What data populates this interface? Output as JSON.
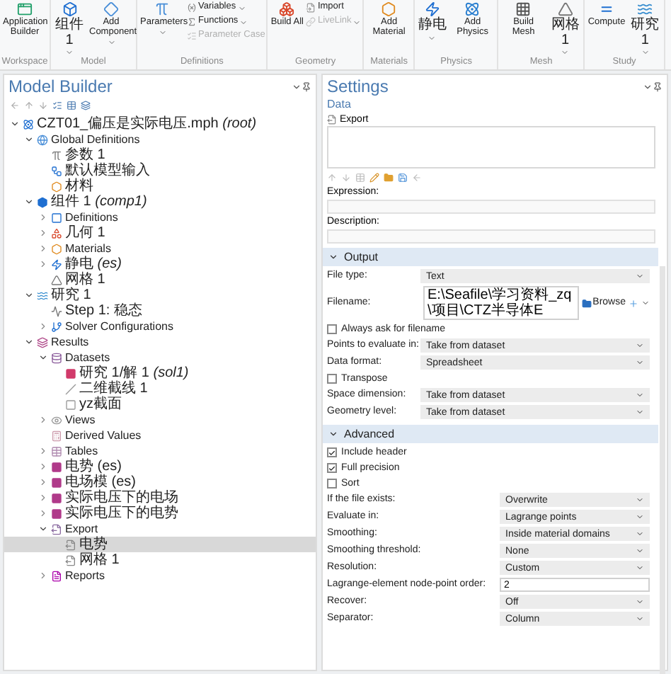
{
  "ribbon": {
    "groups": [
      {
        "label": "Workspace",
        "buttons": [
          {
            "kind": "app",
            "label": "Application Builder",
            "dropdown": false,
            "disabled": false
          }
        ]
      },
      {
        "label": "Model",
        "buttons": [
          {
            "kind": "component",
            "label": "组件 1",
            "dropdown": true,
            "disabled": false
          },
          {
            "kind": "add-component",
            "label": "Add Component",
            "dropdown": true,
            "disabled": false
          }
        ]
      },
      {
        "label": "Definitions",
        "buttons": [
          {
            "kind": "parameters",
            "label": "Parameters",
            "dropdown": true,
            "disabled": false
          }
        ],
        "small": [
          {
            "kind": "variables",
            "label": "Variables",
            "dropdown": true,
            "disabled": false
          },
          {
            "kind": "functions",
            "label": "Functions",
            "dropdown": true,
            "disabled": false
          },
          {
            "kind": "param-case",
            "label": "Parameter Case",
            "dropdown": false,
            "disabled": true
          }
        ]
      },
      {
        "label": "Geometry",
        "buttons": [
          {
            "kind": "build",
            "label": "Build All",
            "dropdown": false,
            "disabled": false
          }
        ],
        "small": [
          {
            "kind": "import",
            "label": "Import",
            "dropdown": false,
            "disabled": false
          },
          {
            "kind": "livelink",
            "label": "LiveLink",
            "dropdown": true,
            "disabled": true
          }
        ]
      },
      {
        "label": "Materials",
        "buttons": [
          {
            "kind": "material",
            "label": "Add Material",
            "dropdown": false,
            "disabled": false
          }
        ]
      },
      {
        "label": "Physics",
        "buttons": [
          {
            "kind": "electrostatics",
            "label": "静电",
            "dropdown": true,
            "disabled": false
          },
          {
            "kind": "physics",
            "label": "Add Physics",
            "dropdown": false,
            "disabled": false
          }
        ]
      },
      {
        "label": "Mesh",
        "buttons": [
          {
            "kind": "build-mesh",
            "label": "Build Mesh",
            "dropdown": false,
            "disabled": false
          },
          {
            "kind": "mesh",
            "label": "网格 1",
            "dropdown": true,
            "disabled": false
          }
        ]
      },
      {
        "label": "Study",
        "buttons": [
          {
            "kind": "compute",
            "label": "Compute",
            "dropdown": false,
            "disabled": false
          },
          {
            "kind": "study",
            "label": "研究 1",
            "dropdown": true,
            "disabled": false
          }
        ]
      }
    ]
  },
  "model_builder": {
    "title": "Model Builder",
    "tree": [
      {
        "kind": "root",
        "label": "CZT01_偏压是实际电压.mph *(root)*",
        "expanded": true,
        "selected": false,
        "children": [
          {
            "kind": "globe",
            "label": "Global Definitions",
            "expanded": true,
            "selected": false,
            "children": [
              {
                "kind": "param",
                "label": "参数 1",
                "selected": false
              },
              {
                "kind": "input",
                "label": "默认模型输入",
                "selected": false
              },
              {
                "kind": "material",
                "label": "材料",
                "selected": false
              }
            ]
          },
          {
            "kind": "component",
            "label": "组件 1 *(comp1)*",
            "expanded": true,
            "selected": false,
            "children": [
              {
                "kind": "definitions",
                "label": "Definitions",
                "expanded": false,
                "selected": false
              },
              {
                "kind": "geometry",
                "label": "几何 1",
                "expanded": false,
                "selected": false
              },
              {
                "kind": "material",
                "label": "Materials",
                "expanded": false,
                "selected": false
              },
              {
                "kind": "physics",
                "label": "静电 *(es)*",
                "expanded": false,
                "selected": false
              },
              {
                "kind": "mesh",
                "label": "网格 1",
                "selected": false
              }
            ]
          },
          {
            "kind": "study",
            "label": "研究 1",
            "expanded": true,
            "selected": false,
            "children": [
              {
                "kind": "step",
                "label": "Step 1: 稳态",
                "selected": false
              },
              {
                "kind": "solver",
                "label": "Solver Configurations",
                "expanded": false,
                "selected": false
              }
            ]
          },
          {
            "kind": "results",
            "label": "Results",
            "expanded": true,
            "selected": false,
            "children": [
              {
                "kind": "datasets",
                "label": "Datasets",
                "expanded": true,
                "selected": false,
                "children": [
                  {
                    "kind": "solution",
                    "label": "研究 1/解 1 *(sol1)*",
                    "selected": false
                  },
                  {
                    "kind": "cutline",
                    "label": "二维截线 1",
                    "selected": false
                  },
                  {
                    "kind": "cutplane",
                    "label": "yz截面",
                    "selected": false
                  }
                ]
              },
              {
                "kind": "views",
                "label": "Views",
                "expanded": false,
                "selected": false
              },
              {
                "kind": "derived",
                "label": "Derived Values",
                "selected": false
              },
              {
                "kind": "tables",
                "label": "Tables",
                "expanded": false,
                "selected": false
              },
              {
                "kind": "plot",
                "label": "电势 (es)",
                "expanded": false,
                "selected": false
              },
              {
                "kind": "plot",
                "label": "电场模 (es)",
                "expanded": false,
                "selected": false
              },
              {
                "kind": "plot",
                "label": "实际电压下的电场",
                "expanded": false,
                "selected": false
              },
              {
                "kind": "plot",
                "label": "实际电压下的电势",
                "expanded": false,
                "selected": false
              },
              {
                "kind": "export",
                "label": "Export",
                "expanded": true,
                "selected": false,
                "children": [
                  {
                    "kind": "exportitem",
                    "label": "电势",
                    "selected": true
                  },
                  {
                    "kind": "exportitem",
                    "label": "网格 1",
                    "selected": false
                  }
                ]
              },
              {
                "kind": "reports",
                "label": "Reports",
                "expanded": false,
                "selected": false
              }
            ]
          }
        ]
      }
    ]
  },
  "settings": {
    "title": "Settings",
    "subtitle": "Data",
    "node_label": "Export",
    "expression_label": "Expression:",
    "description_label": "Description:",
    "sections": [
      {
        "title": "Output",
        "expanded": true,
        "rows": [
          {
            "kind": "select",
            "label": "File type:",
            "value": "Text"
          },
          {
            "kind": "filename",
            "label": "Filename:",
            "value": "E:\\Seafile\\学习资料_zq\\项目\\CTZ半导体E",
            "button": "Browse"
          },
          {
            "kind": "checkbox",
            "label": "Always ask for filename",
            "checked": false
          },
          {
            "kind": "select",
            "label": "Points to evaluate in:",
            "value": "Take from dataset"
          },
          {
            "kind": "select",
            "label": "Data format:",
            "value": "Spreadsheet"
          },
          {
            "kind": "checkbox",
            "label": "Transpose",
            "checked": false
          },
          {
            "kind": "select",
            "label": "Space dimension:",
            "value": "Take from dataset"
          },
          {
            "kind": "select",
            "label": "Geometry level:",
            "value": "Take from dataset"
          }
        ]
      },
      {
        "title": "Advanced",
        "expanded": true,
        "rows": [
          {
            "kind": "checkbox",
            "label": "Include header",
            "checked": true
          },
          {
            "kind": "checkbox",
            "label": "Full precision",
            "checked": true
          },
          {
            "kind": "checkbox",
            "label": "Sort",
            "checked": false
          },
          {
            "kind": "select",
            "label": "If the file exists:",
            "value": "Overwrite"
          },
          {
            "kind": "select",
            "label": "Evaluate in:",
            "value": "Lagrange points"
          },
          {
            "kind": "select",
            "label": "Smoothing:",
            "value": "Inside material domains"
          },
          {
            "kind": "select",
            "label": "Smoothing threshold:",
            "value": "None"
          },
          {
            "kind": "select",
            "label": "Resolution:",
            "value": "Custom"
          },
          {
            "kind": "input",
            "label": "Lagrange-element node-point order:",
            "value": "2"
          },
          {
            "kind": "select",
            "label": "Recover:",
            "value": "Off"
          },
          {
            "kind": "select",
            "label": "Separator:",
            "value": "Column"
          }
        ]
      }
    ]
  }
}
